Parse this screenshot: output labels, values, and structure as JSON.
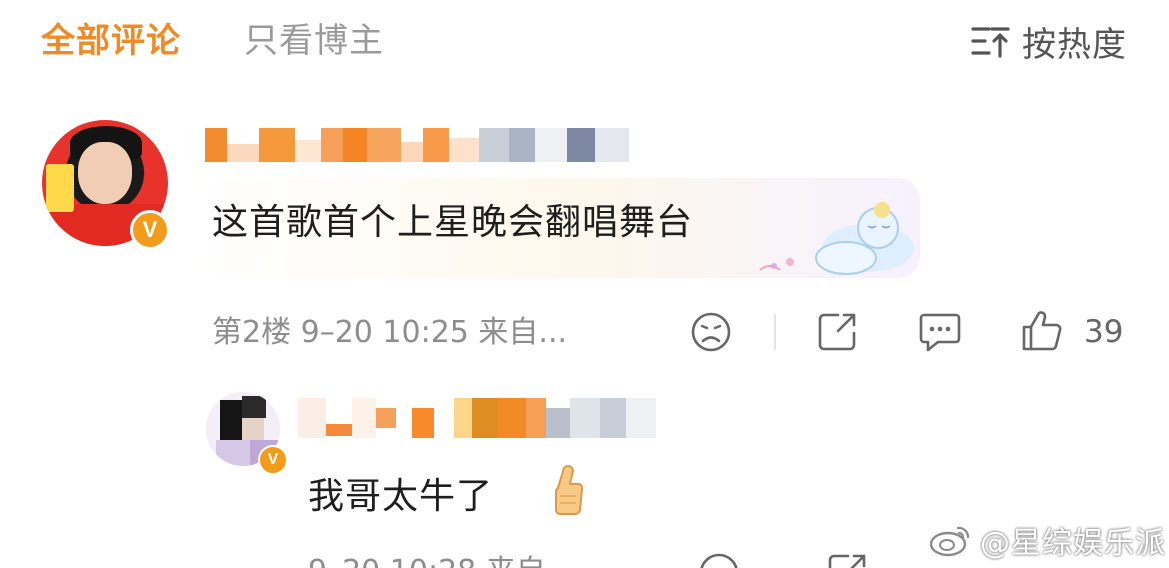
{
  "tabs": {
    "all_comments": "全部评论",
    "author_only": "只看博主",
    "sort_label": "按热度"
  },
  "comments": [
    {
      "text": "这首歌首个上星晚会翻唱舞台",
      "meta": "第2楼 9–20 10:25 来自...",
      "likes": "39",
      "verified_badge": "V"
    },
    {
      "text": "我哥太牛了",
      "meta": "9–20 10:28 来自",
      "verified_badge": "V"
    }
  ],
  "icons": {
    "sort": "sort-icon",
    "dislike": "sad-face-icon",
    "share": "share-icon",
    "comment": "comment-icon",
    "like": "thumbs-up-icon",
    "reply_emoji": "thumbs-up-emoji-icon"
  },
  "watermark": {
    "text": "@星综娱乐派"
  },
  "colors": {
    "accent": "#f08a24",
    "badge": "#f39b1a",
    "muted": "#8d8d8d"
  }
}
